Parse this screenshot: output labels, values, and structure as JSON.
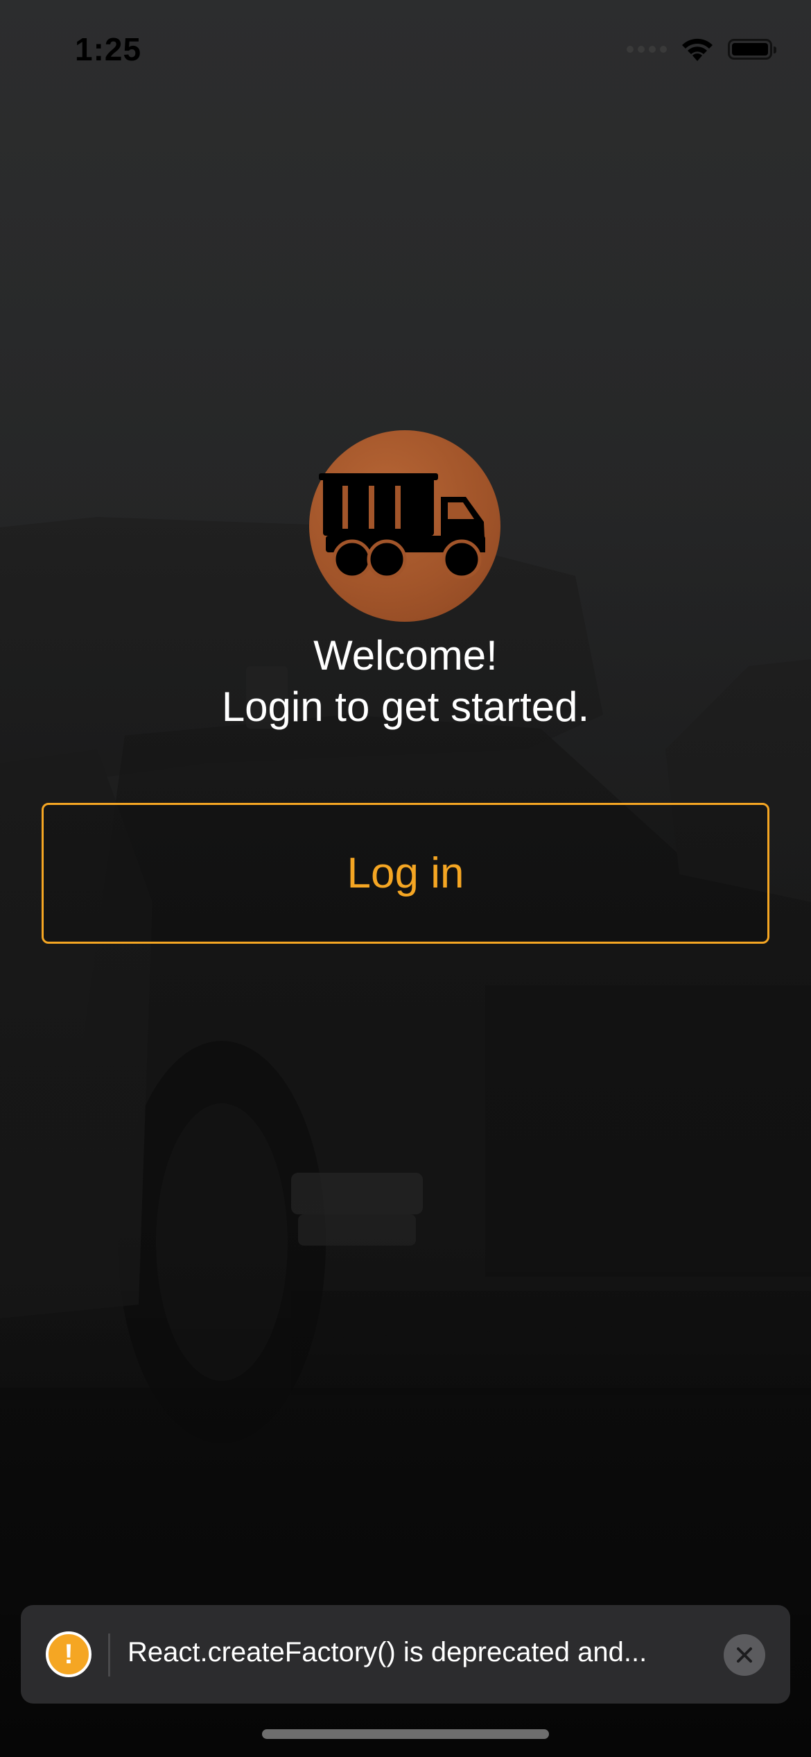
{
  "status_bar": {
    "time": "1:25",
    "icons": [
      "cellular-signal-icon",
      "wifi-icon",
      "battery-icon"
    ]
  },
  "logo": {
    "icon": "dump-truck-icon",
    "color": "#a2552a"
  },
  "welcome": {
    "line1": "Welcome!",
    "line2": "Login to get started."
  },
  "login_button": {
    "label": "Log in",
    "accent_color": "#f5a623"
  },
  "warning_toast": {
    "icon": "warning-icon",
    "icon_glyph": "!",
    "message": "React.createFactory() is deprecated and...",
    "close_icon": "close-icon"
  }
}
